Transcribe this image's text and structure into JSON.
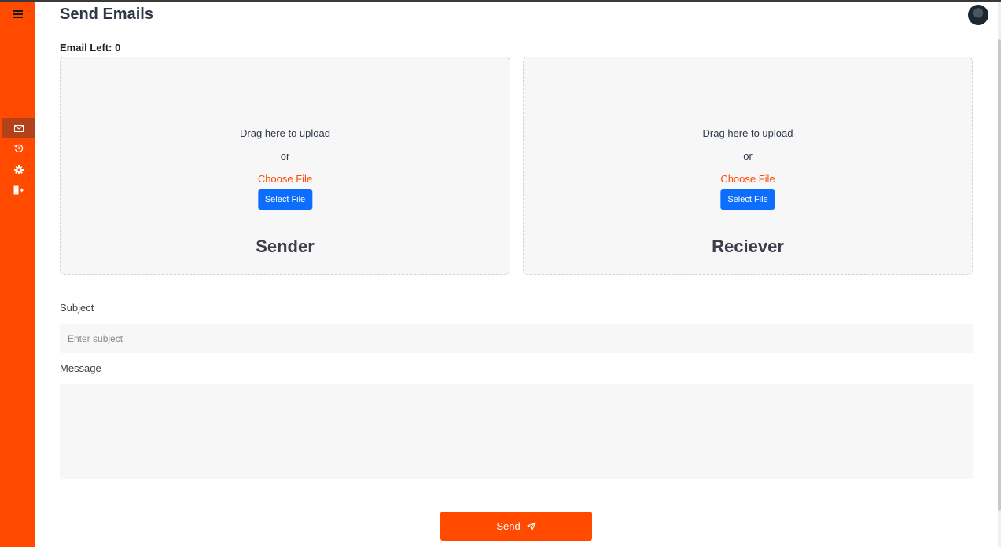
{
  "page": {
    "title": "Send Emails",
    "email_left": "Email Left: 0"
  },
  "sidebar": {
    "items": [
      {
        "icon": "envelope-icon",
        "active": true
      },
      {
        "icon": "history-icon",
        "active": false
      },
      {
        "icon": "gear-icon",
        "active": false
      },
      {
        "icon": "logout-icon",
        "active": false
      }
    ]
  },
  "upload": {
    "sender": {
      "drag_text": "Drag here to upload",
      "or_text": "or",
      "choose_text": "Choose File",
      "button_label": "Select File",
      "title": "Sender"
    },
    "receiver": {
      "drag_text": "Drag here to upload",
      "or_text": "or",
      "choose_text": "Choose File",
      "button_label": "Select File",
      "title": "Reciever"
    }
  },
  "form": {
    "subject_label": "Subject",
    "subject_placeholder": "Enter subject",
    "subject_value": "",
    "message_label": "Message",
    "message_value": ""
  },
  "actions": {
    "send_label": "Send"
  },
  "colors": {
    "accent": "#ff4a00",
    "primary_button": "#0d6efd",
    "active_sidebar": "#b3421a"
  }
}
